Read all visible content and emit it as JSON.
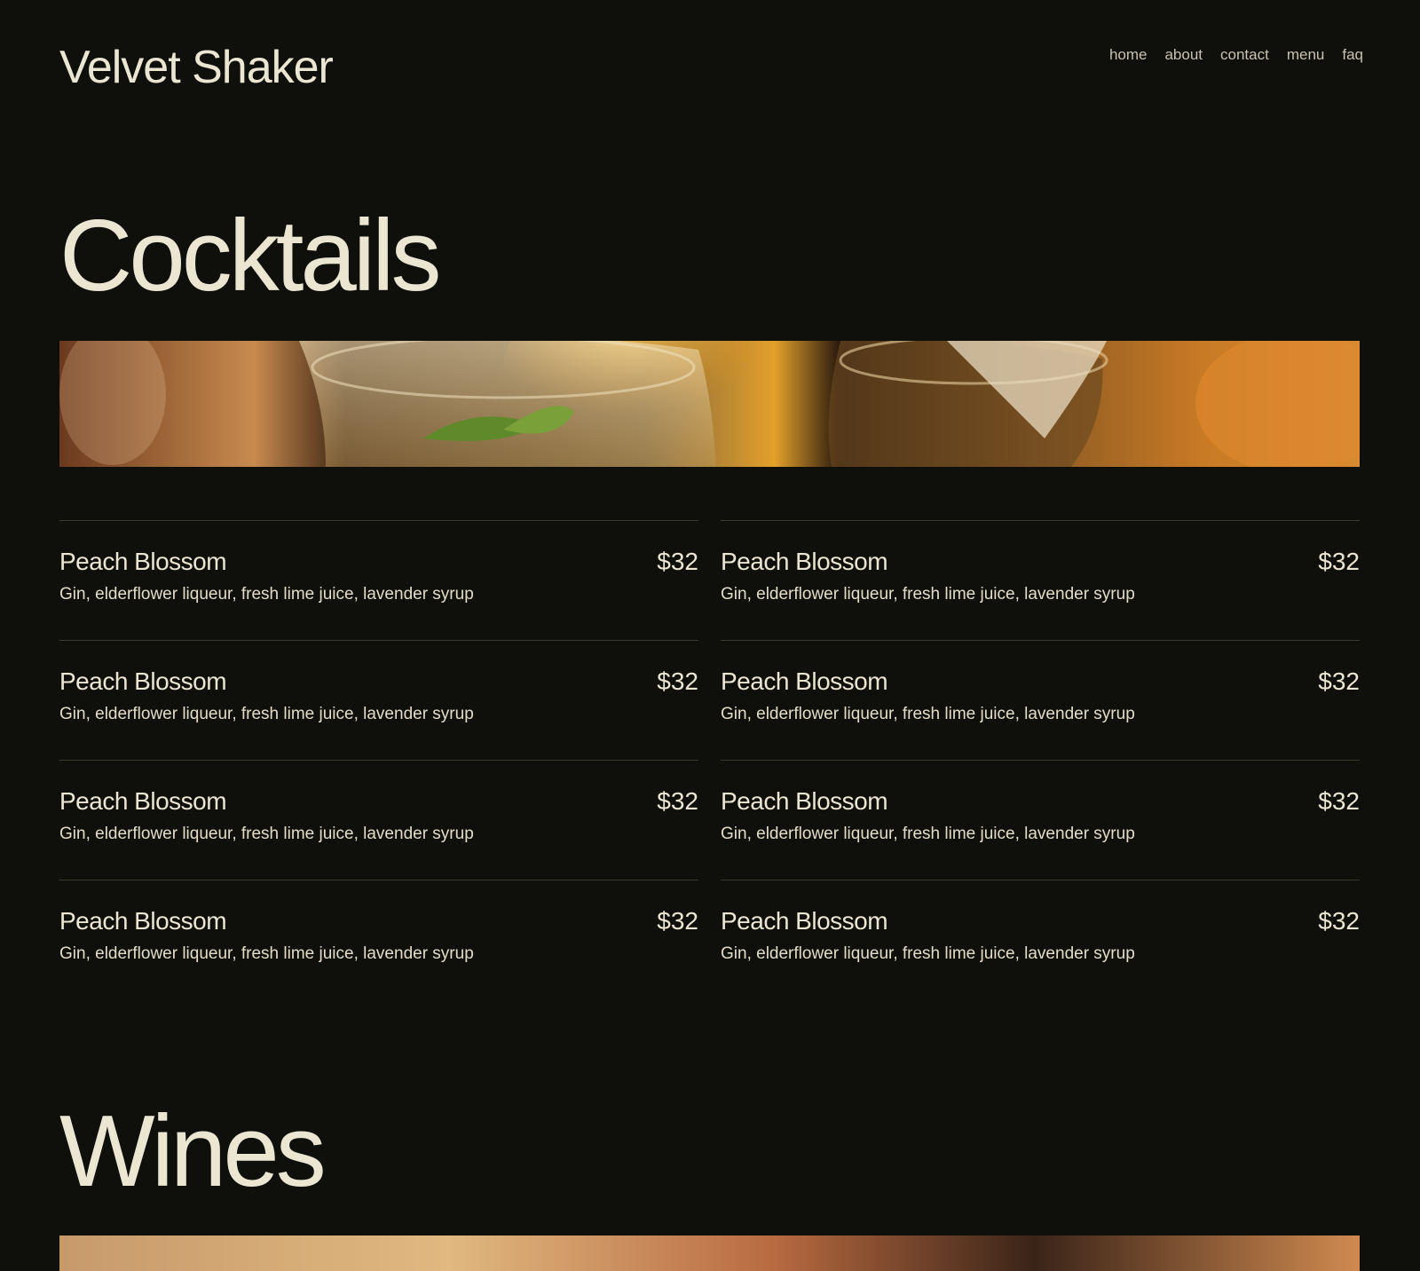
{
  "site": {
    "brand": "Velvet Shaker",
    "nav": [
      {
        "label": "home"
      },
      {
        "label": "about"
      },
      {
        "label": "contact"
      },
      {
        "label": "menu"
      },
      {
        "label": "faq"
      }
    ]
  },
  "colors": {
    "background": "#0f0f0c",
    "text": "#ebe6d2",
    "nav_text": "#c8c2b0",
    "divider": "#3a382f"
  },
  "sections": {
    "cocktails": {
      "title": "Cocktails",
      "items": [
        {
          "name": "Peach Blossom",
          "price": "$32",
          "description": "Gin, elderflower liqueur, fresh lime juice, lavender syrup"
        },
        {
          "name": "Peach Blossom",
          "price": "$32",
          "description": "Gin, elderflower liqueur, fresh lime juice, lavender syrup"
        },
        {
          "name": "Peach Blossom",
          "price": "$32",
          "description": "Gin, elderflower liqueur, fresh lime juice, lavender syrup"
        },
        {
          "name": "Peach Blossom",
          "price": "$32",
          "description": "Gin, elderflower liqueur, fresh lime juice, lavender syrup"
        },
        {
          "name": "Peach Blossom",
          "price": "$32",
          "description": "Gin, elderflower liqueur, fresh lime juice, lavender syrup"
        },
        {
          "name": "Peach Blossom",
          "price": "$32",
          "description": "Gin, elderflower liqueur, fresh lime juice, lavender syrup"
        },
        {
          "name": "Peach Blossom",
          "price": "$32",
          "description": "Gin, elderflower liqueur, fresh lime juice, lavender syrup"
        },
        {
          "name": "Peach Blossom",
          "price": "$32",
          "description": "Gin, elderflower liqueur, fresh lime juice, lavender syrup"
        }
      ]
    },
    "wines": {
      "title": "Wines"
    }
  }
}
